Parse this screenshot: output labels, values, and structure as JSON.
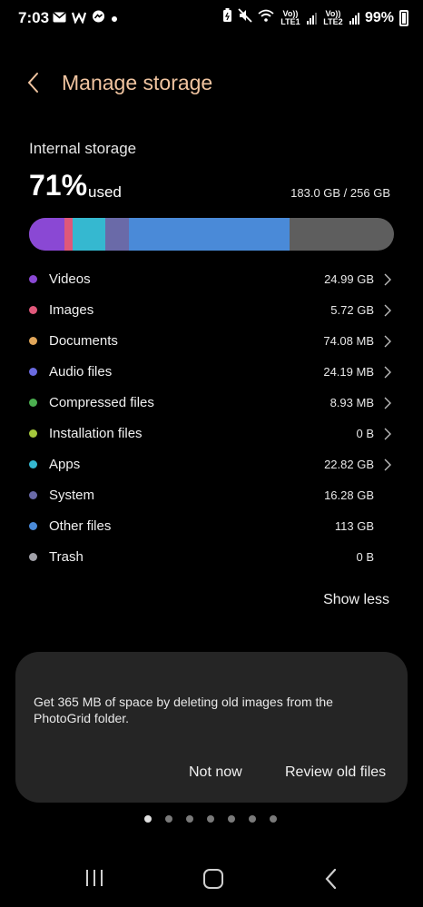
{
  "status_bar": {
    "time": "7:03",
    "left_icons": [
      "mail-icon",
      "w-app-icon",
      "messenger-icon",
      "dot-icon"
    ],
    "volte1": "Vo)) LTE1",
    "volte2": "Vo)) LTE2",
    "battery": "99%"
  },
  "header": {
    "title": "Manage storage"
  },
  "storage": {
    "section_title": "Internal storage",
    "used_percent": "71%",
    "used_word": "used",
    "used_amount": "183.0 GB / 256 GB",
    "used_fraction": 0.71
  },
  "categories": [
    {
      "label": "Videos",
      "size": "24.99 GB",
      "color": "#8a48d4",
      "chevron": true
    },
    {
      "label": "Images",
      "size": "5.72 GB",
      "color": "#e0587a",
      "chevron": true
    },
    {
      "label": "Documents",
      "size": "74.08 MB",
      "color": "#e0a65a",
      "chevron": true
    },
    {
      "label": "Audio files",
      "size": "24.19 MB",
      "color": "#6a6ae0",
      "chevron": true
    },
    {
      "label": "Compressed files",
      "size": "8.93 MB",
      "color": "#4caf50",
      "chevron": true
    },
    {
      "label": "Installation files",
      "size": "0 B",
      "color": "#a5c83c",
      "chevron": true
    },
    {
      "label": "Apps",
      "size": "22.82 GB",
      "color": "#35b8d0",
      "chevron": true
    },
    {
      "label": "System",
      "size": "16.28 GB",
      "color": "#6a6aa8",
      "chevron": false
    },
    {
      "label": "Other files",
      "size": "113 GB",
      "color": "#4a8ad8",
      "chevron": false
    },
    {
      "label": "Trash",
      "size": "0 B",
      "color": "#a0a0a8",
      "chevron": false
    }
  ],
  "show_less": "Show less",
  "suggestion": {
    "text": "Get 365 MB of space by deleting old images from the PhotoGrid folder.",
    "not_now": "Not now",
    "review": "Review old files"
  },
  "pager": {
    "count": 7,
    "active_index": 0
  },
  "navbar": [
    "recent-apps-icon",
    "home-icon",
    "back-icon"
  ]
}
